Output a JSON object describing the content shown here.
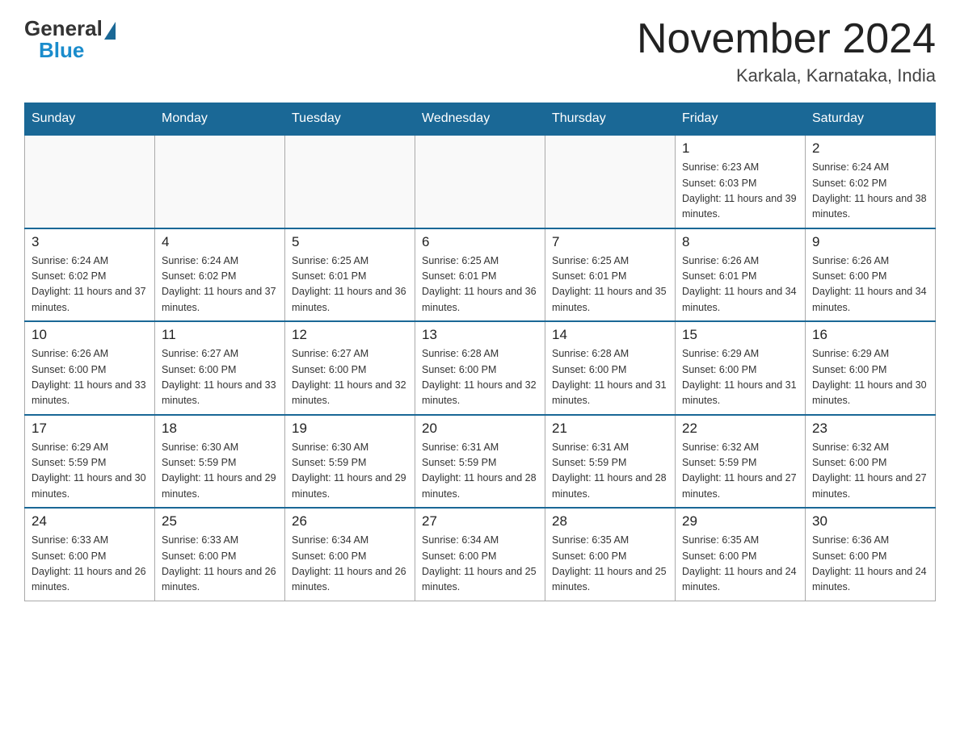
{
  "header": {
    "logo_general": "General",
    "logo_blue": "Blue",
    "month_title": "November 2024",
    "location": "Karkala, Karnataka, India"
  },
  "days_of_week": [
    "Sunday",
    "Monday",
    "Tuesday",
    "Wednesday",
    "Thursday",
    "Friday",
    "Saturday"
  ],
  "weeks": [
    [
      {
        "day": "",
        "info": ""
      },
      {
        "day": "",
        "info": ""
      },
      {
        "day": "",
        "info": ""
      },
      {
        "day": "",
        "info": ""
      },
      {
        "day": "",
        "info": ""
      },
      {
        "day": "1",
        "info": "Sunrise: 6:23 AM\nSunset: 6:03 PM\nDaylight: 11 hours and 39 minutes."
      },
      {
        "day": "2",
        "info": "Sunrise: 6:24 AM\nSunset: 6:02 PM\nDaylight: 11 hours and 38 minutes."
      }
    ],
    [
      {
        "day": "3",
        "info": "Sunrise: 6:24 AM\nSunset: 6:02 PM\nDaylight: 11 hours and 37 minutes."
      },
      {
        "day": "4",
        "info": "Sunrise: 6:24 AM\nSunset: 6:02 PM\nDaylight: 11 hours and 37 minutes."
      },
      {
        "day": "5",
        "info": "Sunrise: 6:25 AM\nSunset: 6:01 PM\nDaylight: 11 hours and 36 minutes."
      },
      {
        "day": "6",
        "info": "Sunrise: 6:25 AM\nSunset: 6:01 PM\nDaylight: 11 hours and 36 minutes."
      },
      {
        "day": "7",
        "info": "Sunrise: 6:25 AM\nSunset: 6:01 PM\nDaylight: 11 hours and 35 minutes."
      },
      {
        "day": "8",
        "info": "Sunrise: 6:26 AM\nSunset: 6:01 PM\nDaylight: 11 hours and 34 minutes."
      },
      {
        "day": "9",
        "info": "Sunrise: 6:26 AM\nSunset: 6:00 PM\nDaylight: 11 hours and 34 minutes."
      }
    ],
    [
      {
        "day": "10",
        "info": "Sunrise: 6:26 AM\nSunset: 6:00 PM\nDaylight: 11 hours and 33 minutes."
      },
      {
        "day": "11",
        "info": "Sunrise: 6:27 AM\nSunset: 6:00 PM\nDaylight: 11 hours and 33 minutes."
      },
      {
        "day": "12",
        "info": "Sunrise: 6:27 AM\nSunset: 6:00 PM\nDaylight: 11 hours and 32 minutes."
      },
      {
        "day": "13",
        "info": "Sunrise: 6:28 AM\nSunset: 6:00 PM\nDaylight: 11 hours and 32 minutes."
      },
      {
        "day": "14",
        "info": "Sunrise: 6:28 AM\nSunset: 6:00 PM\nDaylight: 11 hours and 31 minutes."
      },
      {
        "day": "15",
        "info": "Sunrise: 6:29 AM\nSunset: 6:00 PM\nDaylight: 11 hours and 31 minutes."
      },
      {
        "day": "16",
        "info": "Sunrise: 6:29 AM\nSunset: 6:00 PM\nDaylight: 11 hours and 30 minutes."
      }
    ],
    [
      {
        "day": "17",
        "info": "Sunrise: 6:29 AM\nSunset: 5:59 PM\nDaylight: 11 hours and 30 minutes."
      },
      {
        "day": "18",
        "info": "Sunrise: 6:30 AM\nSunset: 5:59 PM\nDaylight: 11 hours and 29 minutes."
      },
      {
        "day": "19",
        "info": "Sunrise: 6:30 AM\nSunset: 5:59 PM\nDaylight: 11 hours and 29 minutes."
      },
      {
        "day": "20",
        "info": "Sunrise: 6:31 AM\nSunset: 5:59 PM\nDaylight: 11 hours and 28 minutes."
      },
      {
        "day": "21",
        "info": "Sunrise: 6:31 AM\nSunset: 5:59 PM\nDaylight: 11 hours and 28 minutes."
      },
      {
        "day": "22",
        "info": "Sunrise: 6:32 AM\nSunset: 5:59 PM\nDaylight: 11 hours and 27 minutes."
      },
      {
        "day": "23",
        "info": "Sunrise: 6:32 AM\nSunset: 6:00 PM\nDaylight: 11 hours and 27 minutes."
      }
    ],
    [
      {
        "day": "24",
        "info": "Sunrise: 6:33 AM\nSunset: 6:00 PM\nDaylight: 11 hours and 26 minutes."
      },
      {
        "day": "25",
        "info": "Sunrise: 6:33 AM\nSunset: 6:00 PM\nDaylight: 11 hours and 26 minutes."
      },
      {
        "day": "26",
        "info": "Sunrise: 6:34 AM\nSunset: 6:00 PM\nDaylight: 11 hours and 26 minutes."
      },
      {
        "day": "27",
        "info": "Sunrise: 6:34 AM\nSunset: 6:00 PM\nDaylight: 11 hours and 25 minutes."
      },
      {
        "day": "28",
        "info": "Sunrise: 6:35 AM\nSunset: 6:00 PM\nDaylight: 11 hours and 25 minutes."
      },
      {
        "day": "29",
        "info": "Sunrise: 6:35 AM\nSunset: 6:00 PM\nDaylight: 11 hours and 24 minutes."
      },
      {
        "day": "30",
        "info": "Sunrise: 6:36 AM\nSunset: 6:00 PM\nDaylight: 11 hours and 24 minutes."
      }
    ]
  ]
}
